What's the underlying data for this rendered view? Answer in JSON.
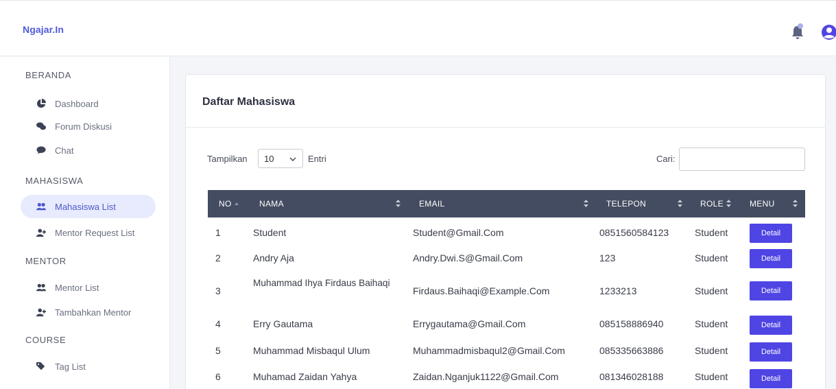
{
  "app": {
    "brand": "Ngajar.In"
  },
  "header": {
    "notification_icon": "bell-icon",
    "user_icon": "user-circle-icon"
  },
  "sidebar": {
    "sections": [
      {
        "title": "BERANDA",
        "items": [
          {
            "label": "Dashboard",
            "icon": "chart-pie-icon"
          },
          {
            "label": "Forum Diskusi",
            "icon": "comments-icon"
          },
          {
            "label": "Chat",
            "icon": "chat-bubble-icon"
          }
        ]
      },
      {
        "title": "MAHASISWA",
        "items": [
          {
            "label": "Mahasiswa List",
            "icon": "users-icon",
            "active": true
          },
          {
            "label": "Mentor Request List",
            "icon": "user-plus-icon"
          }
        ]
      },
      {
        "title": "MENTOR",
        "items": [
          {
            "label": "Mentor List",
            "icon": "users-icon"
          },
          {
            "label": "Tambahkan Mentor",
            "icon": "user-plus-icon"
          }
        ]
      },
      {
        "title": "COURSE",
        "items": [
          {
            "label": "Tag List",
            "icon": "tags-icon"
          }
        ]
      }
    ]
  },
  "main": {
    "title": "Daftar Mahasiswa",
    "length": {
      "prefix": "Tampilkan",
      "value": "10",
      "suffix": "Entri"
    },
    "search": {
      "label": "Cari:",
      "value": ""
    },
    "columns": [
      "NO",
      "NAMA",
      "EMAIL",
      "TELEPON",
      "ROLE",
      "MENU"
    ],
    "detail_label": "Detail",
    "rows": [
      {
        "no": "1",
        "nama": "Student",
        "email": "Student@Gmail.Com",
        "telepon": "0851560584123",
        "role": "Student"
      },
      {
        "no": "2",
        "nama": "Andry Aja",
        "email": "Andry.Dwi.S@Gmail.Com",
        "telepon": "123",
        "role": "Student"
      },
      {
        "no": "3",
        "nama": "Muhammad Ihya Firdaus Baihaqi",
        "email": "Firdaus.Baihaqi@Example.Com",
        "telepon": "1233213",
        "role": "Student"
      },
      {
        "no": "4",
        "nama": "Erry Gautama",
        "email": "Errygautama@Gmail.Com",
        "telepon": "085158886940",
        "role": "Student"
      },
      {
        "no": "5",
        "nama": "Muhammad Misbaqul Ulum",
        "email": "Muhammadmisbaqul2@Gmail.Com",
        "telepon": "085335663886",
        "role": "Student"
      },
      {
        "no": "6",
        "nama": "Muhamad Zaidan Yahya",
        "email": "Zaidan.Nganjuk1122@Gmail.Com",
        "telepon": "081346028188",
        "role": "Student"
      }
    ]
  },
  "colors": {
    "brand": "#4e5bd8",
    "button": "#4f45e4",
    "table_header": "#434c60",
    "active_nav_bg": "#e8ebfd"
  }
}
